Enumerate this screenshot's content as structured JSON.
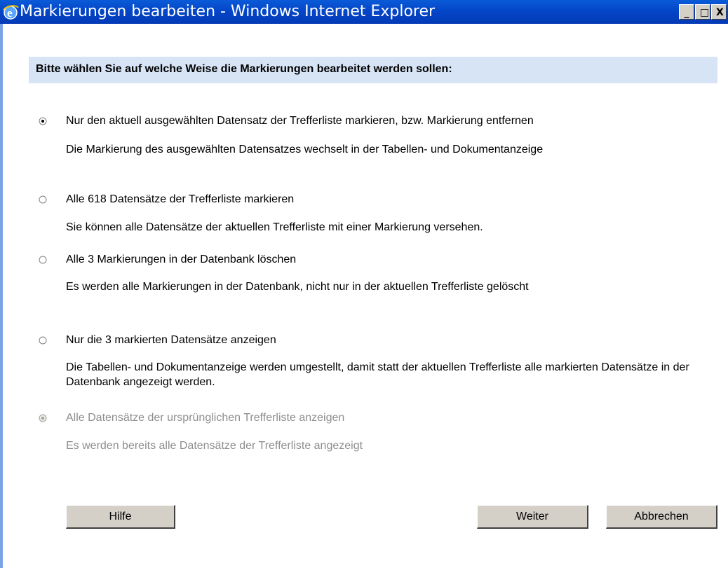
{
  "window": {
    "title": "Markierungen bearbeiten - Windows Internet Explorer",
    "minimize": "_",
    "maximize": "□",
    "close": "X"
  },
  "header": "Bitte wählen Sie auf welche Weise die Markierungen bearbeitet werden sollen:",
  "options": [
    {
      "label": "Nur den aktuell ausgewählten Datensatz der Trefferliste markieren, bzw. Markierung entfernen",
      "description": "Die Markierung des ausgewählten Datensatzes wechselt in der Tabellen- und Dokumentanzeige",
      "selected": true,
      "enabled": true
    },
    {
      "label": "Alle 618 Datensätze der Trefferliste markieren",
      "description": "Sie können alle Datensätze der aktuellen Trefferliste mit einer Markierung versehen.",
      "selected": false,
      "enabled": true
    },
    {
      "label": "Alle 3 Markierungen in der Datenbank löschen",
      "description": "Es werden alle Markierungen in der Datenbank, nicht nur in der aktuellen Trefferliste gelöscht",
      "selected": false,
      "enabled": true
    },
    {
      "label": "Nur die 3 markierten Datensätze anzeigen",
      "description": "Die Tabellen- und Dokumentanzeige werden umgestellt, damit statt der aktuellen Trefferliste alle markierten Datensätze in der Datenbank angezeigt werden.",
      "selected": false,
      "enabled": true
    },
    {
      "label": "Alle Datensätze der ursprünglichen Trefferliste anzeigen",
      "description": "Es werden bereits alle Datensätze der Trefferliste angezeigt",
      "selected": false,
      "enabled": false
    }
  ],
  "buttons": {
    "help": "Hilfe",
    "next": "Weiter",
    "cancel": "Abbrechen"
  },
  "colors": {
    "titlebar": "#0446c8",
    "header_bg": "#d7e4f5",
    "disabled_text": "#8e8e8e",
    "button_face": "#d4d0c8"
  },
  "icons": {
    "app": "internet-explorer-icon"
  }
}
